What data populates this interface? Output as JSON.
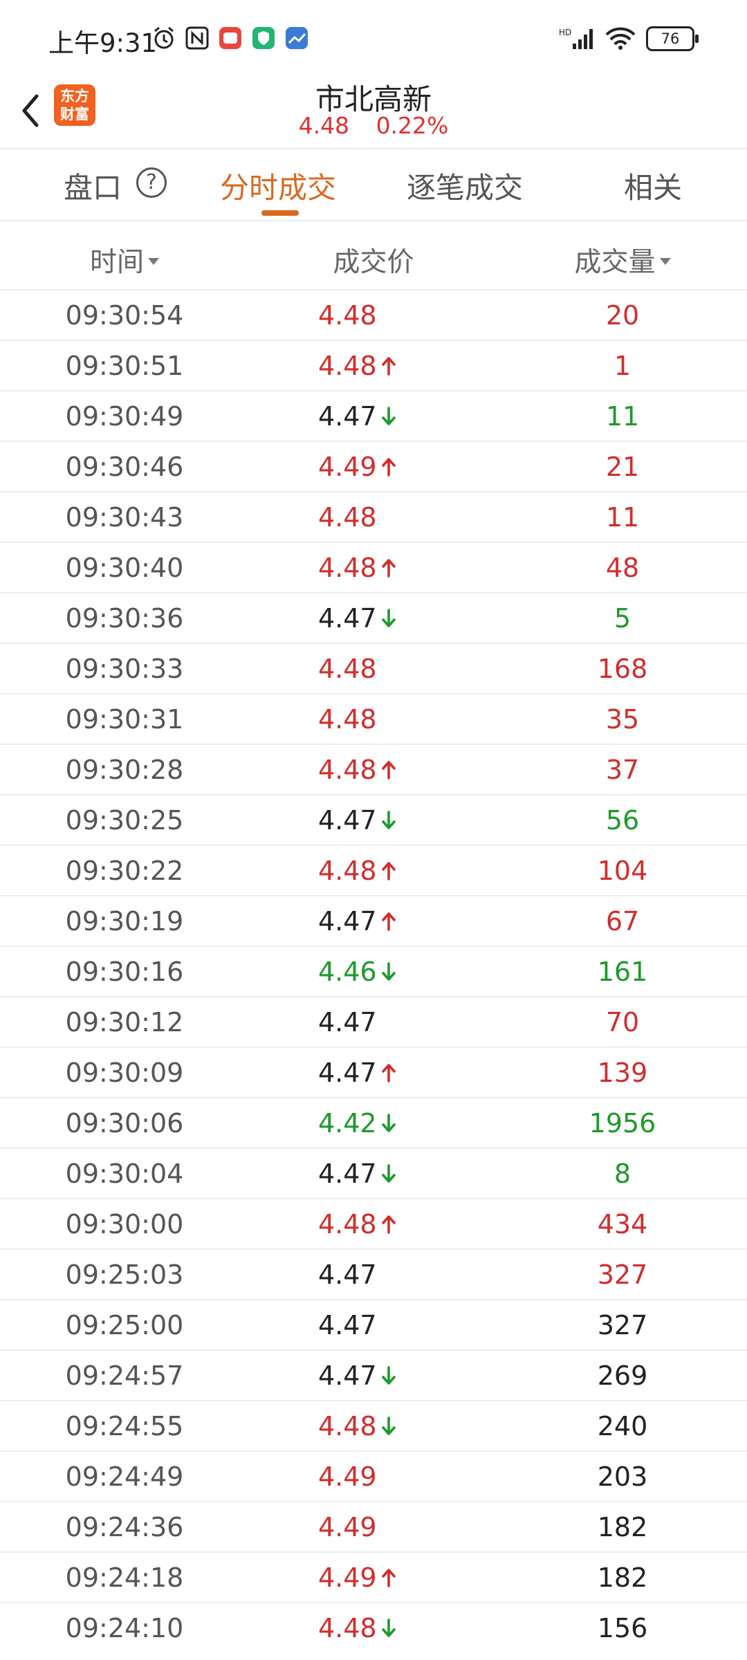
{
  "status_bar": {
    "time": "上午9:31",
    "battery": "76",
    "network": "HD"
  },
  "header": {
    "title": "市北高新",
    "price": "4.48",
    "change_pct": "0.22%",
    "logo_text_line1": "东方",
    "logo_text_line2": "财富"
  },
  "tabs": [
    {
      "label": "盘口"
    },
    {
      "label": "分时成交"
    },
    {
      "label": "逐笔成交"
    },
    {
      "label": "相关"
    }
  ],
  "columns": {
    "time": "时间",
    "price": "成交价",
    "volume": "成交量"
  },
  "colors": {
    "up": "#d22d2d",
    "down": "#1c9a2a",
    "neutral": "#222222",
    "accent": "#d9691c",
    "logo": "#f2611f"
  },
  "trades": [
    {
      "time": "09:30:54",
      "price": "4.48",
      "price_color": "red",
      "arrow": "",
      "volume": "20",
      "volume_color": "red"
    },
    {
      "time": "09:30:51",
      "price": "4.48",
      "price_color": "red",
      "arrow": "up",
      "volume": "1",
      "volume_color": "red"
    },
    {
      "time": "09:30:49",
      "price": "4.47",
      "price_color": "black",
      "arrow": "down",
      "volume": "11",
      "volume_color": "green"
    },
    {
      "time": "09:30:46",
      "price": "4.49",
      "price_color": "red",
      "arrow": "up",
      "volume": "21",
      "volume_color": "red"
    },
    {
      "time": "09:30:43",
      "price": "4.48",
      "price_color": "red",
      "arrow": "",
      "volume": "11",
      "volume_color": "red"
    },
    {
      "time": "09:30:40",
      "price": "4.48",
      "price_color": "red",
      "arrow": "up",
      "volume": "48",
      "volume_color": "red"
    },
    {
      "time": "09:30:36",
      "price": "4.47",
      "price_color": "black",
      "arrow": "down",
      "volume": "5",
      "volume_color": "green"
    },
    {
      "time": "09:30:33",
      "price": "4.48",
      "price_color": "red",
      "arrow": "",
      "volume": "168",
      "volume_color": "red"
    },
    {
      "time": "09:30:31",
      "price": "4.48",
      "price_color": "red",
      "arrow": "",
      "volume": "35",
      "volume_color": "red"
    },
    {
      "time": "09:30:28",
      "price": "4.48",
      "price_color": "red",
      "arrow": "up",
      "volume": "37",
      "volume_color": "red"
    },
    {
      "time": "09:30:25",
      "price": "4.47",
      "price_color": "black",
      "arrow": "down",
      "volume": "56",
      "volume_color": "green"
    },
    {
      "time": "09:30:22",
      "price": "4.48",
      "price_color": "red",
      "arrow": "up",
      "volume": "104",
      "volume_color": "red"
    },
    {
      "time": "09:30:19",
      "price": "4.47",
      "price_color": "black",
      "arrow": "up",
      "volume": "67",
      "volume_color": "red"
    },
    {
      "time": "09:30:16",
      "price": "4.46",
      "price_color": "green",
      "arrow": "down",
      "volume": "161",
      "volume_color": "green"
    },
    {
      "time": "09:30:12",
      "price": "4.47",
      "price_color": "black",
      "arrow": "",
      "volume": "70",
      "volume_color": "red"
    },
    {
      "time": "09:30:09",
      "price": "4.47",
      "price_color": "black",
      "arrow": "up",
      "volume": "139",
      "volume_color": "red"
    },
    {
      "time": "09:30:06",
      "price": "4.42",
      "price_color": "green",
      "arrow": "down",
      "volume": "1956",
      "volume_color": "green"
    },
    {
      "time": "09:30:04",
      "price": "4.47",
      "price_color": "black",
      "arrow": "down",
      "volume": "8",
      "volume_color": "green"
    },
    {
      "time": "09:30:00",
      "price": "4.48",
      "price_color": "red",
      "arrow": "up",
      "volume": "434",
      "volume_color": "red"
    },
    {
      "time": "09:25:03",
      "price": "4.47",
      "price_color": "black",
      "arrow": "",
      "volume": "327",
      "volume_color": "red"
    },
    {
      "time": "09:25:00",
      "price": "4.47",
      "price_color": "black",
      "arrow": "",
      "volume": "327",
      "volume_color": "black"
    },
    {
      "time": "09:24:57",
      "price": "4.47",
      "price_color": "black",
      "arrow": "down",
      "volume": "269",
      "volume_color": "black"
    },
    {
      "time": "09:24:55",
      "price": "4.48",
      "price_color": "red",
      "arrow": "down",
      "volume": "240",
      "volume_color": "black"
    },
    {
      "time": "09:24:49",
      "price": "4.49",
      "price_color": "red",
      "arrow": "",
      "volume": "203",
      "volume_color": "black"
    },
    {
      "time": "09:24:36",
      "price": "4.49",
      "price_color": "red",
      "arrow": "",
      "volume": "182",
      "volume_color": "black"
    },
    {
      "time": "09:24:18",
      "price": "4.49",
      "price_color": "red",
      "arrow": "up",
      "volume": "182",
      "volume_color": "black"
    },
    {
      "time": "09:24:10",
      "price": "4.48",
      "price_color": "red",
      "arrow": "down",
      "volume": "156",
      "volume_color": "black"
    }
  ]
}
